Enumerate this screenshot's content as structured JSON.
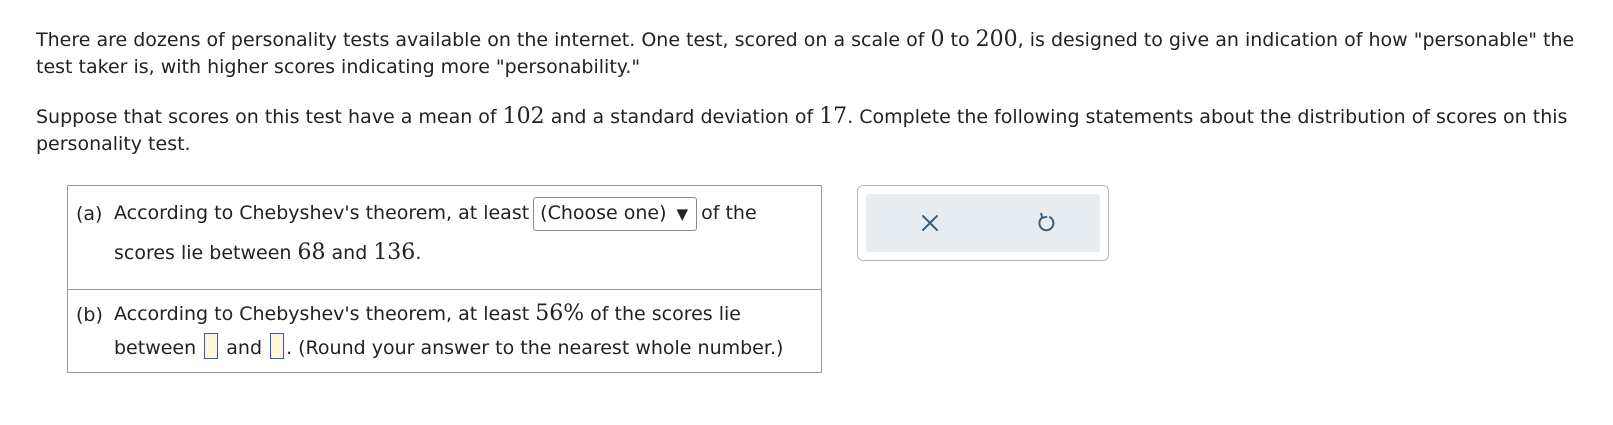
{
  "intro": {
    "p1_part1": "There are dozens of personality tests available on the internet. One test, scored on a scale of ",
    "p1_min": "0",
    "p1_to": " to ",
    "p1_max": "200",
    "p1_part2": ", is designed to give an indication of how \"personable\" the test taker is, with higher scores indicating more \"personability.\"",
    "p2_part1": "Suppose that scores on this test have a mean of ",
    "p2_mean": "102",
    "p2_part2": " and a standard deviation of ",
    "p2_sd": "17",
    "p2_part3": ". Complete the following statements about the distribution of scores on this personality test."
  },
  "part_a": {
    "label": "(a)",
    "text_before": "According to Chebyshev's theorem, at least",
    "select_value": "(Choose one)",
    "caret": "▼",
    "text_after": "of the",
    "line2_before": "scores lie between ",
    "low": "68",
    "and": " and ",
    "high": "136",
    "period": "."
  },
  "part_b": {
    "label": "(b)",
    "line1_before": "According to Chebyshev's theorem, at least ",
    "percent": "56%",
    "line1_after": " of the scores lie",
    "line2_between": "between",
    "line2_and": "and",
    "line2_after": ". (Round your answer to the nearest whole number.)"
  },
  "tools": {
    "clear_icon": "x-icon",
    "undo_icon": "undo-icon"
  },
  "colors": {
    "input_border": "#3a56c4",
    "input_fill": "#fff6d6",
    "tools_bg": "#e6ecef",
    "icon": "#3a5f7a"
  }
}
